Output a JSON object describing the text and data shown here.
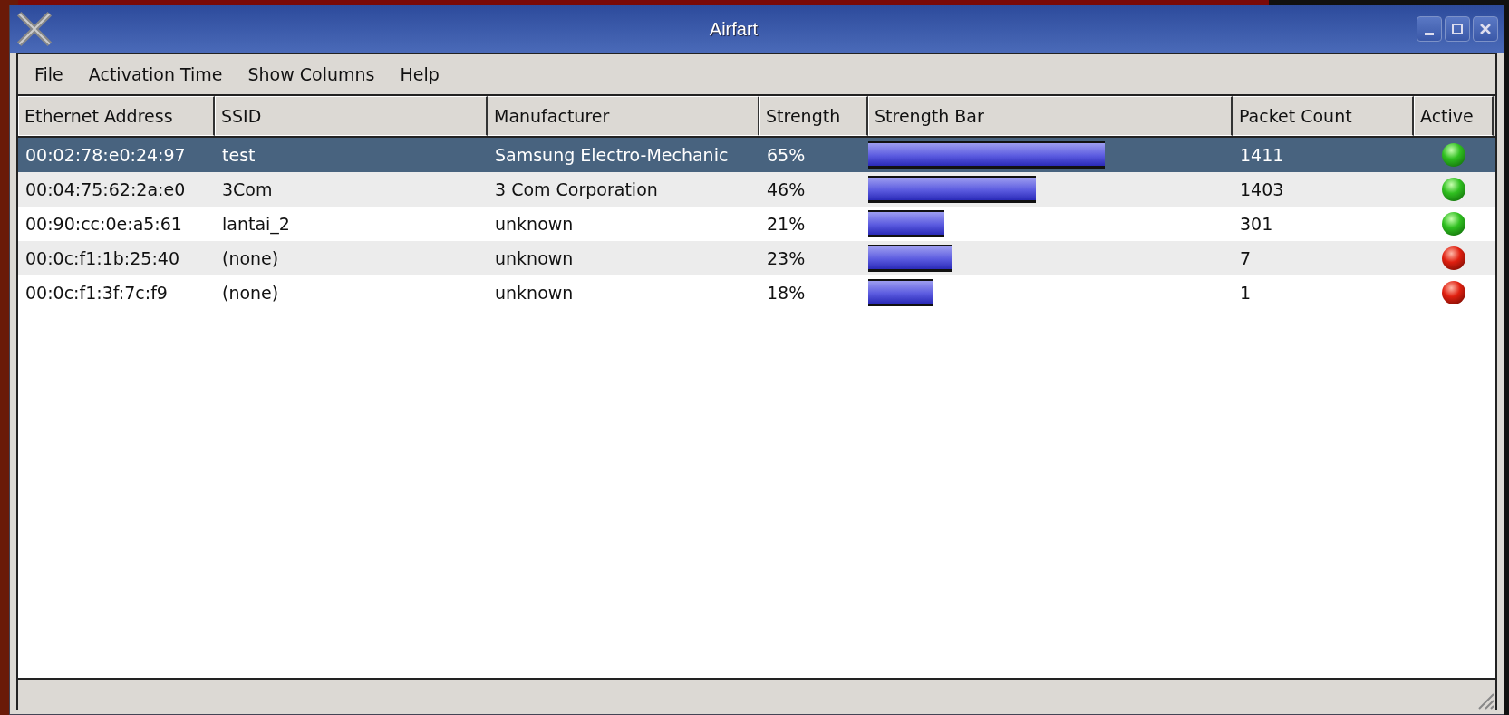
{
  "window": {
    "title": "Airfart"
  },
  "menu": [
    {
      "label": "File"
    },
    {
      "label": "Activation Time"
    },
    {
      "label": "Show Columns"
    },
    {
      "label": "Help"
    }
  ],
  "table": {
    "columns": [
      "Ethernet Address",
      "SSID",
      "Manufacturer",
      "Strength",
      "Strength Bar",
      "Packet Count",
      "Active"
    ],
    "rows": [
      {
        "address": "00:02:78:e0:24:97",
        "ssid": "test",
        "manufacturer": "Samsung Electro-Mechanic",
        "strength": "65%",
        "packets": "1411",
        "active": true,
        "selected": true
      },
      {
        "address": "00:04:75:62:2a:e0",
        "ssid": "3Com",
        "manufacturer": "3 Com Corporation",
        "strength": "46%",
        "packets": "1403",
        "active": true,
        "selected": false
      },
      {
        "address": "00:90:cc:0e:a5:61",
        "ssid": "lantai_2",
        "manufacturer": "unknown",
        "strength": "21%",
        "packets": "301",
        "active": true,
        "selected": false
      },
      {
        "address": "00:0c:f1:1b:25:40",
        "ssid": "(none)",
        "manufacturer": "unknown",
        "strength": "23%",
        "packets": "7",
        "active": false,
        "selected": false
      },
      {
        "address": "00:0c:f1:3f:7c:f9",
        "ssid": "(none)",
        "manufacturer": "unknown",
        "strength": "18%",
        "packets": "1",
        "active": false,
        "selected": false
      }
    ]
  }
}
